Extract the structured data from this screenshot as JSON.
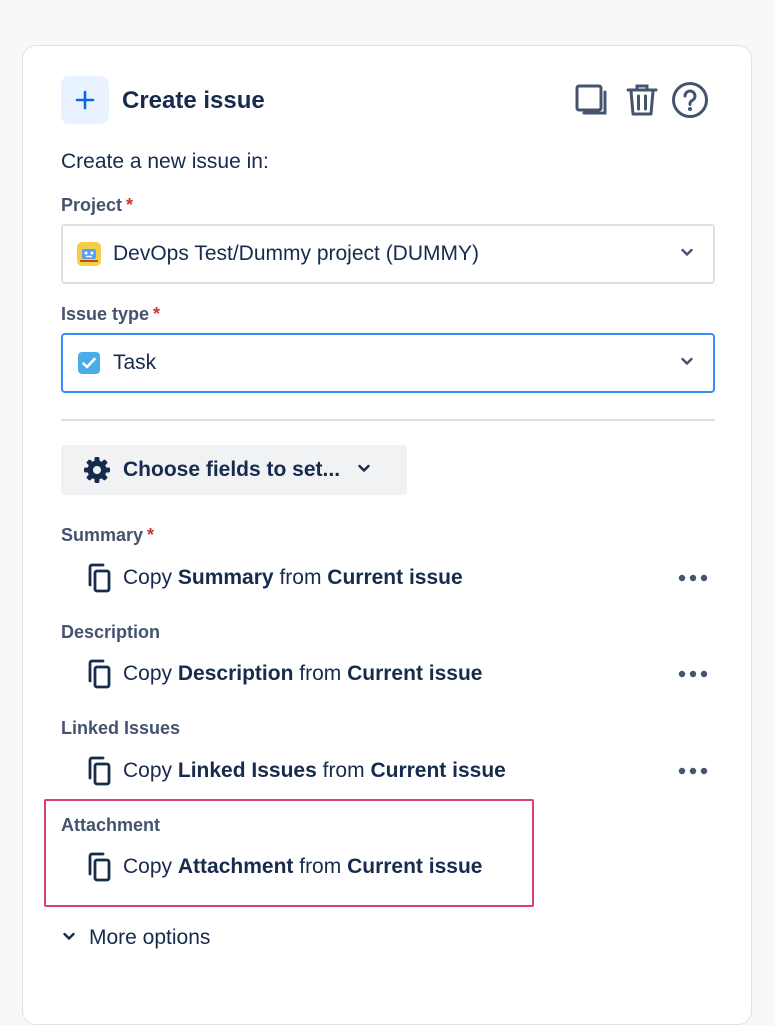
{
  "header": {
    "title": "Create issue",
    "icons": [
      "plus-icon",
      "duplicate-icon",
      "trash-icon",
      "help-icon"
    ]
  },
  "intro": "Create a new issue in:",
  "project": {
    "label": "Project",
    "required": "*",
    "value": "DevOps Test/Dummy project (DUMMY)"
  },
  "issue_type": {
    "label": "Issue type",
    "required": "*",
    "value": "Task"
  },
  "choose_fields": {
    "label": "Choose fields to set..."
  },
  "fields": [
    {
      "label": "Summary",
      "required": "*",
      "copy": "Copy",
      "field": "Summary",
      "from": "from",
      "source": "Current issue",
      "has_menu": true
    },
    {
      "label": "Description",
      "required": "",
      "copy": "Copy",
      "field": "Description",
      "from": "from",
      "source": "Current issue",
      "has_menu": true
    },
    {
      "label": "Linked Issues",
      "required": "",
      "copy": "Copy",
      "field": "Linked Issues",
      "from": "from",
      "source": "Current issue",
      "has_menu": true
    },
    {
      "label": "Attachment",
      "required": "",
      "copy": "Copy",
      "field": "Attachment",
      "from": "from",
      "source": "Current issue",
      "has_menu": false
    }
  ],
  "more_options": "More options",
  "colors": {
    "accent_blue": "#388bff",
    "required_red": "#c9372c",
    "highlight_pink": "#d6417a",
    "text_dark": "#172b4d",
    "label_gray": "#44546f"
  }
}
